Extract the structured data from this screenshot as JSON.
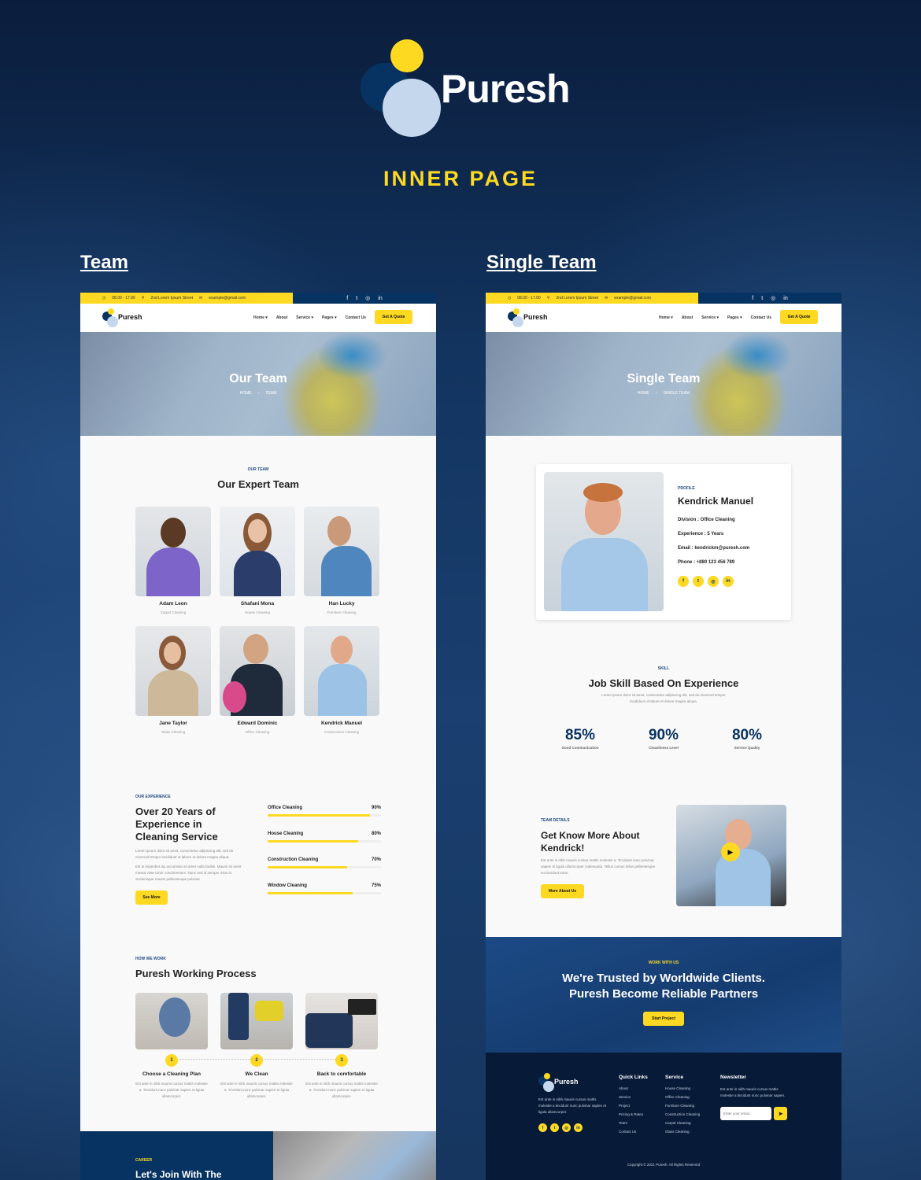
{
  "brand": {
    "name": "Puresh",
    "subtitle": "INNER PAGE"
  },
  "colors": {
    "primary": "#073363",
    "accent": "#fdd922",
    "light": "#c4d7ec"
  },
  "pages": [
    {
      "label": "Team"
    },
    {
      "label": "Single Team"
    }
  ],
  "topbar": {
    "hours": "08.00 - 17.00",
    "address": "2nd Lorem Ipsum Street",
    "email": "example@gmail.com",
    "social": [
      "facebook-icon",
      "twitter-icon",
      "instagram-icon",
      "linkedin-icon"
    ]
  },
  "nav": {
    "logo": "Puresh",
    "menu": [
      "Home",
      "About",
      "Service",
      "Pages",
      "Contact Us"
    ],
    "cta": "Get A Quote"
  },
  "team_page": {
    "banner_title": "Our Team",
    "breadcrumb": [
      "HOME",
      "TEAM"
    ],
    "team_eyebrow": "OUR TEAM",
    "team_title": "Our Expert Team",
    "members": [
      {
        "name": "Adam Leon",
        "role": "Carpet Cleaning"
      },
      {
        "name": "Shafani Mona",
        "role": "House Cleaning"
      },
      {
        "name": "Han Lucky",
        "role": "Furniture Cleaning"
      },
      {
        "name": "Jane Taylor",
        "role": "Glass Cleaning"
      },
      {
        "name": "Edward Dominic",
        "role": "Office Cleaning"
      },
      {
        "name": "Kendrick Manuel",
        "role": "Construction Cleaning"
      }
    ],
    "experience": {
      "eyebrow": "OUR EXPERIENCE",
      "title": "Over 20 Years of Experience in Cleaning Service",
      "p1": "Lorem ipsum dolor sit amet, consectetur adipiscing elit, sed do eiusmod tempor incididunt ut labore et dolore magna aliqua.",
      "p2": "Elit at imperdiet dui accumsan sit amet nulla facilisi. Mauris sit amet massa vitae tortor condimentum. Nunc sed id semper risus in. Scelerisque mauris pellentesque pulvinar",
      "button": "See More",
      "skills": [
        {
          "label": "Office Cleaning",
          "percent": 90,
          "text": "90%"
        },
        {
          "label": "House Cleaning",
          "percent": 80,
          "text": "80%"
        },
        {
          "label": "Construction Cleaning",
          "percent": 70,
          "text": "70%"
        },
        {
          "label": "Window Cleaning",
          "percent": 75,
          "text": "75%"
        }
      ]
    },
    "process": {
      "eyebrow": "HOW WE WORK",
      "title": "Puresh Working Process",
      "steps": [
        {
          "num": "1",
          "title": "Choose a Cleaning Plan",
          "desc": "Est ante in nibh mauris cursus mattis molestie a. Tincidunt nunc pulvinar sapien et ligula ullamcorper."
        },
        {
          "num": "2",
          "title": "We Clean",
          "desc": "Est ante in nibh mauris cursus mattis molestie a. Tincidunt nunc pulvinar sapien et ligula ullamcorper."
        },
        {
          "num": "3",
          "title": "Back to comfortable",
          "desc": "Est ante in nibh mauris cursus mattis molestie a. Tincidunt nunc pulvinar sapien et ligula ullamcorper."
        }
      ]
    },
    "career": {
      "eyebrow": "CAREER",
      "title": "Let's Join With The"
    }
  },
  "single_page": {
    "banner_title": "Single Team",
    "breadcrumb": [
      "HOME",
      "SINGLE TEAM"
    ],
    "profile": {
      "eyebrow": "PROFILE",
      "name": "Kendrick Manuel",
      "division": "Division : Office Cleaning",
      "experience": "Experience : 5 Years",
      "email": "Email : kendrickm@puresh.com",
      "phone": "Phone : +880 123 456 789"
    },
    "skill": {
      "eyebrow": "SKILL",
      "title": "Job Skill Based On Experience",
      "desc": "Lorem ipsum dolor sit amet, consectetur adipiscing elit, sed do eiusmod tempor incididunt ut labore et dolore magna aliqua.",
      "stats": [
        {
          "value": "85%",
          "label": "Good Communication"
        },
        {
          "value": "90%",
          "label": "Cleanliness Level"
        },
        {
          "value": "80%",
          "label": "Service Quality"
        }
      ]
    },
    "details": {
      "eyebrow": "TEAM DETAILS",
      "title": "Get Know More About Kendrick!",
      "desc": "Est ante in nibh mauris cursus mattis molestie a. Tincidunt nunc pulvinar sapien et ligula ullamcorper malesuada. Tellus cursus tellus pellentesque eu tincidunt tortor.",
      "button": "More About Us"
    },
    "trust": {
      "eyebrow": "WORK WITH US",
      "line1": "We're Trusted by Worldwide Clients.",
      "line2": "Puresh Become Reliable Partners",
      "button": "Start Project"
    },
    "footer": {
      "logo": "Puresh",
      "about": "Est ante in nibh mauris cursus mattis molestie a tincidunt nunc pulvinar sapien et ligula ullamcorper.",
      "quick_title": "Quick Links",
      "quick": [
        "About",
        "Service",
        "Project",
        "Pricing & Rates",
        "Team",
        "Contact Us"
      ],
      "service_title": "Service",
      "services": [
        "House Cleaning",
        "Office Cleaning",
        "Furniture Cleaning",
        "Construction Cleaning",
        "Carpet Cleaning",
        "Glass Cleaning"
      ],
      "news_title": "Newsletter",
      "news_text": "Est ante in nibh mauris cursus mattis molestie a tincidunt nunc pulvinar sapien.",
      "email_placeholder": "Enter your email...",
      "copyright": "Copyright © 2021 Puresh. All Rights Reserved"
    }
  }
}
